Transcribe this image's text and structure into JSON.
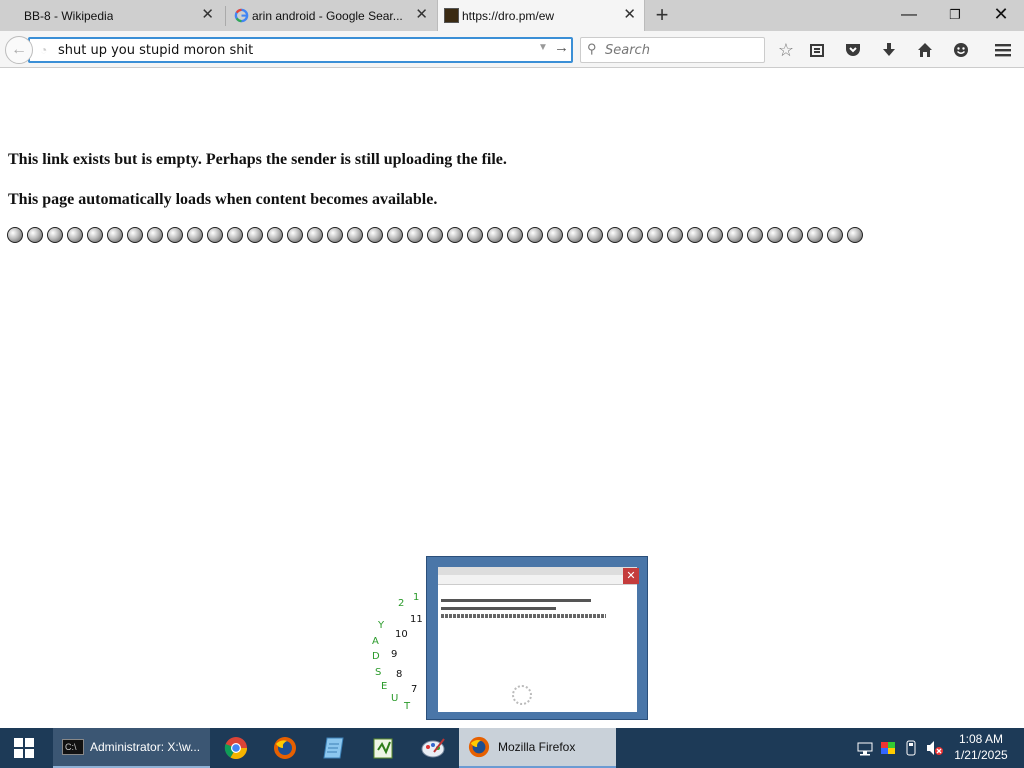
{
  "browser": {
    "tabs": [
      {
        "label": "BB-8 - Wikipedia",
        "active": false
      },
      {
        "label": "arin android - Google Sear...",
        "active": false
      },
      {
        "label": "https://dro.pm/ew",
        "active": true
      }
    ],
    "url_value": "shut up you stupid moron shit",
    "search_placeholder": "Search"
  },
  "page": {
    "line1": "This link exists but is empty. Perhaps the sender is still uploading the file.",
    "line2": "This page automatically loads when content becomes available.",
    "spinner_count": 43
  },
  "overlay_chars": {
    "green": [
      "1",
      "2",
      "Y",
      "A",
      "D",
      "S",
      "E",
      "U",
      "T"
    ],
    "black": [
      "11",
      "10",
      "9",
      "8",
      "7"
    ]
  },
  "taskbar": {
    "cmd_label": "Administrator: X:\\w...",
    "firefox_label": "Mozilla Firefox",
    "time": "1:08 AM",
    "date": "1/21/2025"
  },
  "colors": {
    "accent": "#3b8fd6",
    "taskbar": "#1d3a57",
    "thumbnail_frame": "#4a76a8",
    "green_chars": "#2a9a2a"
  }
}
